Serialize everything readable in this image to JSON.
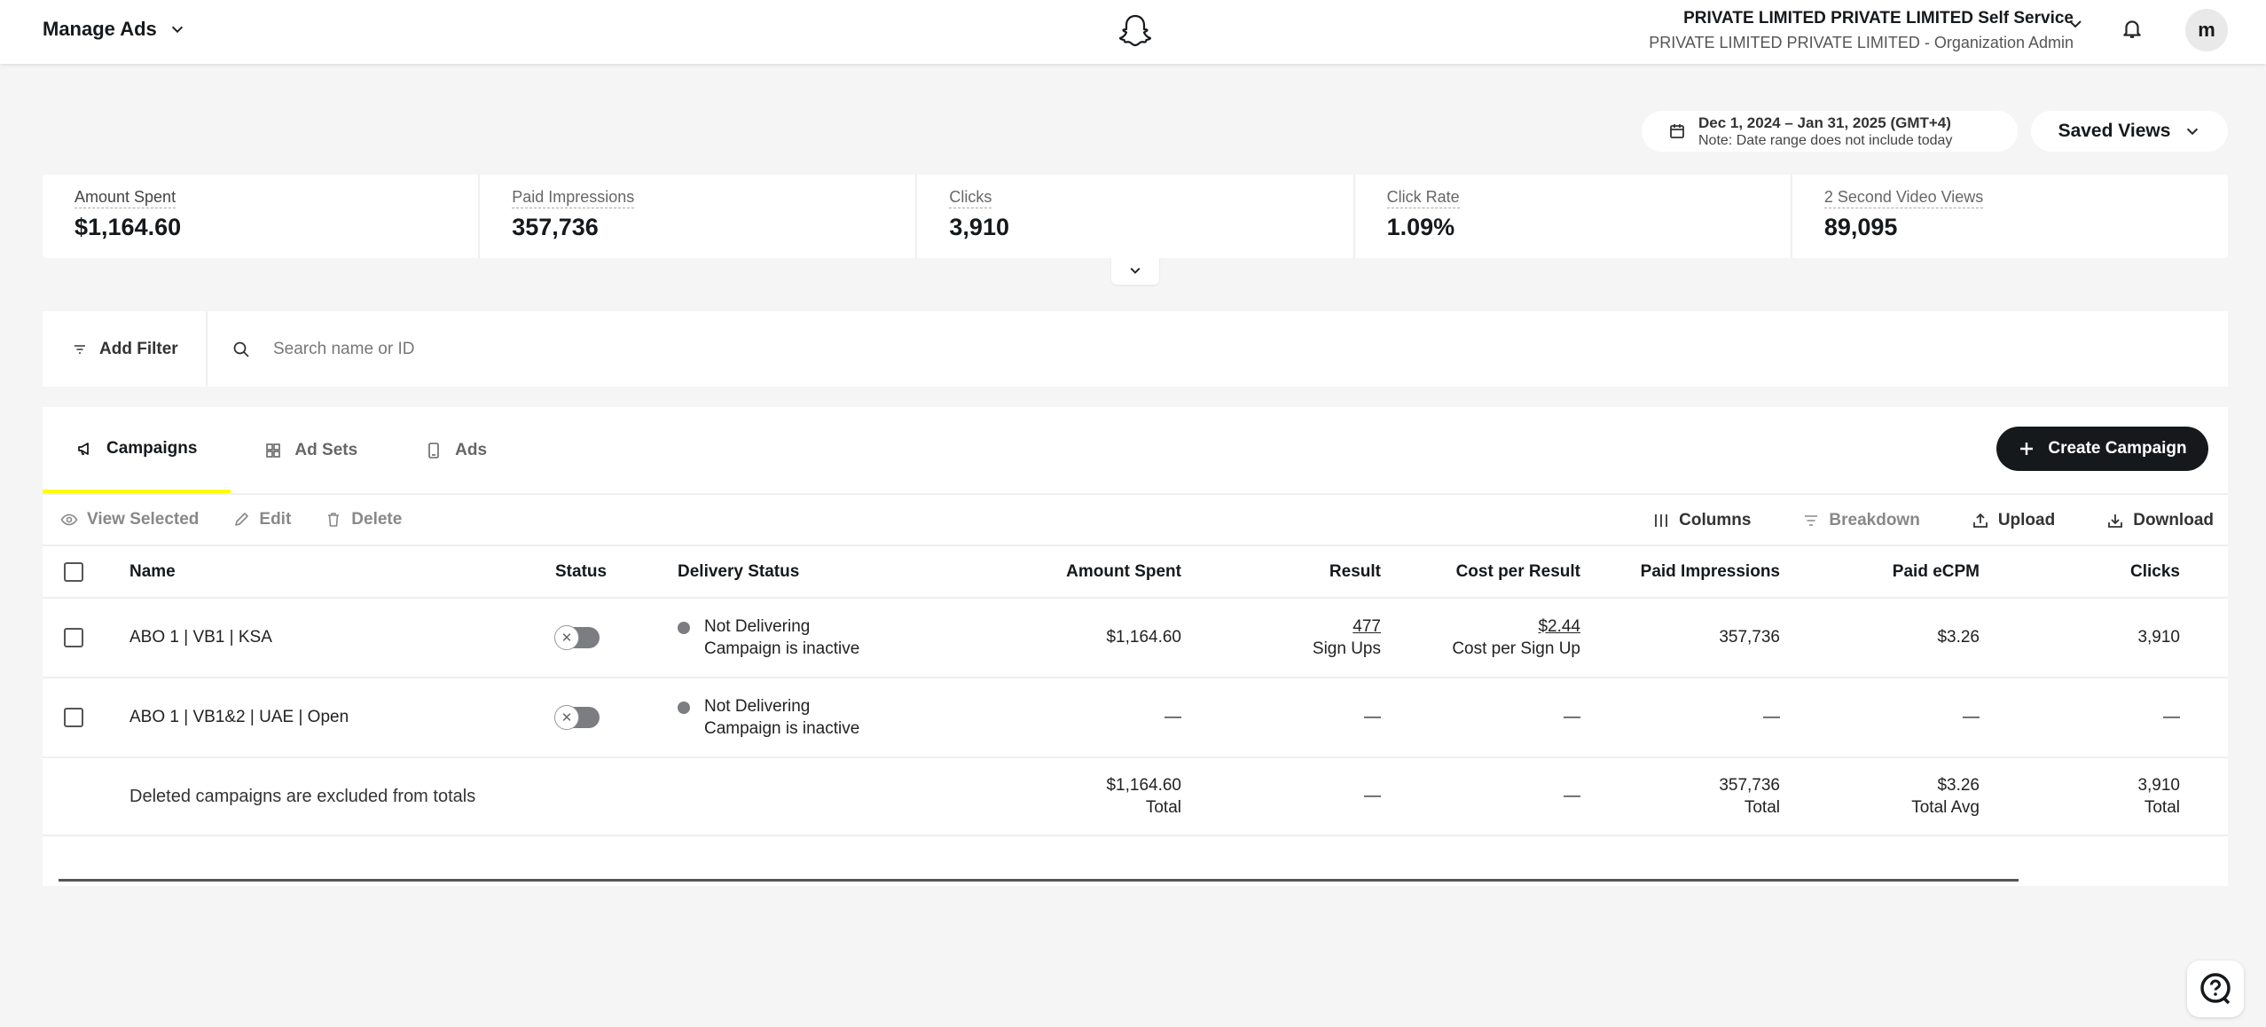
{
  "header": {
    "app_menu_label": "Manage Ads",
    "org_name": "PRIVATE LIMITED PRIVATE LIMITED Self Service",
    "org_role": "PRIVATE LIMITED PRIVATE LIMITED - Organization Admin",
    "avatar_initial": "m"
  },
  "date_range": {
    "label": "Dec 1, 2024 – Jan 31, 2025 (GMT+4)",
    "note": "Note: Date range does not include today"
  },
  "saved_views_label": "Saved Views",
  "metrics": [
    {
      "label": "Amount Spent",
      "value": "$1,164.60"
    },
    {
      "label": "Paid Impressions",
      "value": "357,736"
    },
    {
      "label": "Clicks",
      "value": "3,910"
    },
    {
      "label": "Click Rate",
      "value": "1.09%"
    },
    {
      "label": "2 Second Video Views",
      "value": "89,095"
    }
  ],
  "filter": {
    "add_filter_label": "Add Filter",
    "search_placeholder": "Search name or ID"
  },
  "tabs": [
    {
      "label": "Campaigns",
      "active": true
    },
    {
      "label": "Ad Sets",
      "active": false
    },
    {
      "label": "Ads",
      "active": false
    }
  ],
  "create_campaign_label": "Create Campaign",
  "actions": {
    "view_selected": "View Selected",
    "edit": "Edit",
    "delete": "Delete",
    "columns": "Columns",
    "breakdown": "Breakdown",
    "upload": "Upload",
    "download": "Download"
  },
  "table": {
    "columns": [
      "Name",
      "Status",
      "Delivery Status",
      "Amount Spent",
      "Result",
      "Cost per Result",
      "Paid Impressions",
      "Paid eCPM",
      "Clicks"
    ],
    "rows": [
      {
        "name": "ABO 1 | VB1 | KSA",
        "delivery_status": "Not Delivering",
        "delivery_detail": "Campaign is inactive",
        "amount_spent": "$1,164.60",
        "result": "477",
        "result_unit": "Sign Ups",
        "cost_per_result": "$2.44",
        "cost_per_result_unit": "Cost per Sign Up",
        "paid_impressions": "357,736",
        "paid_ecpm": "$3.26",
        "clicks": "3,910"
      },
      {
        "name": "ABO 1 | VB1&2 | UAE | Open",
        "delivery_status": "Not Delivering",
        "delivery_detail": "Campaign is inactive",
        "amount_spent": "—",
        "result": "—",
        "cost_per_result": "—",
        "paid_impressions": "—",
        "paid_ecpm": "—",
        "clicks": "—"
      }
    ],
    "totals": {
      "note": "Deleted campaigns are excluded from totals",
      "amount_spent": "$1,164.60",
      "amount_spent_label": "Total",
      "result": "—",
      "cost_per_result": "—",
      "paid_impressions": "357,736",
      "paid_impressions_label": "Total",
      "paid_ecpm": "$3.26",
      "paid_ecpm_label": "Total Avg",
      "clicks": "3,910",
      "clicks_label": "Total"
    }
  },
  "colors": {
    "brand_yellow": "#fffc00",
    "button_dark": "#16191c",
    "status_gray": "#7b7d80"
  }
}
